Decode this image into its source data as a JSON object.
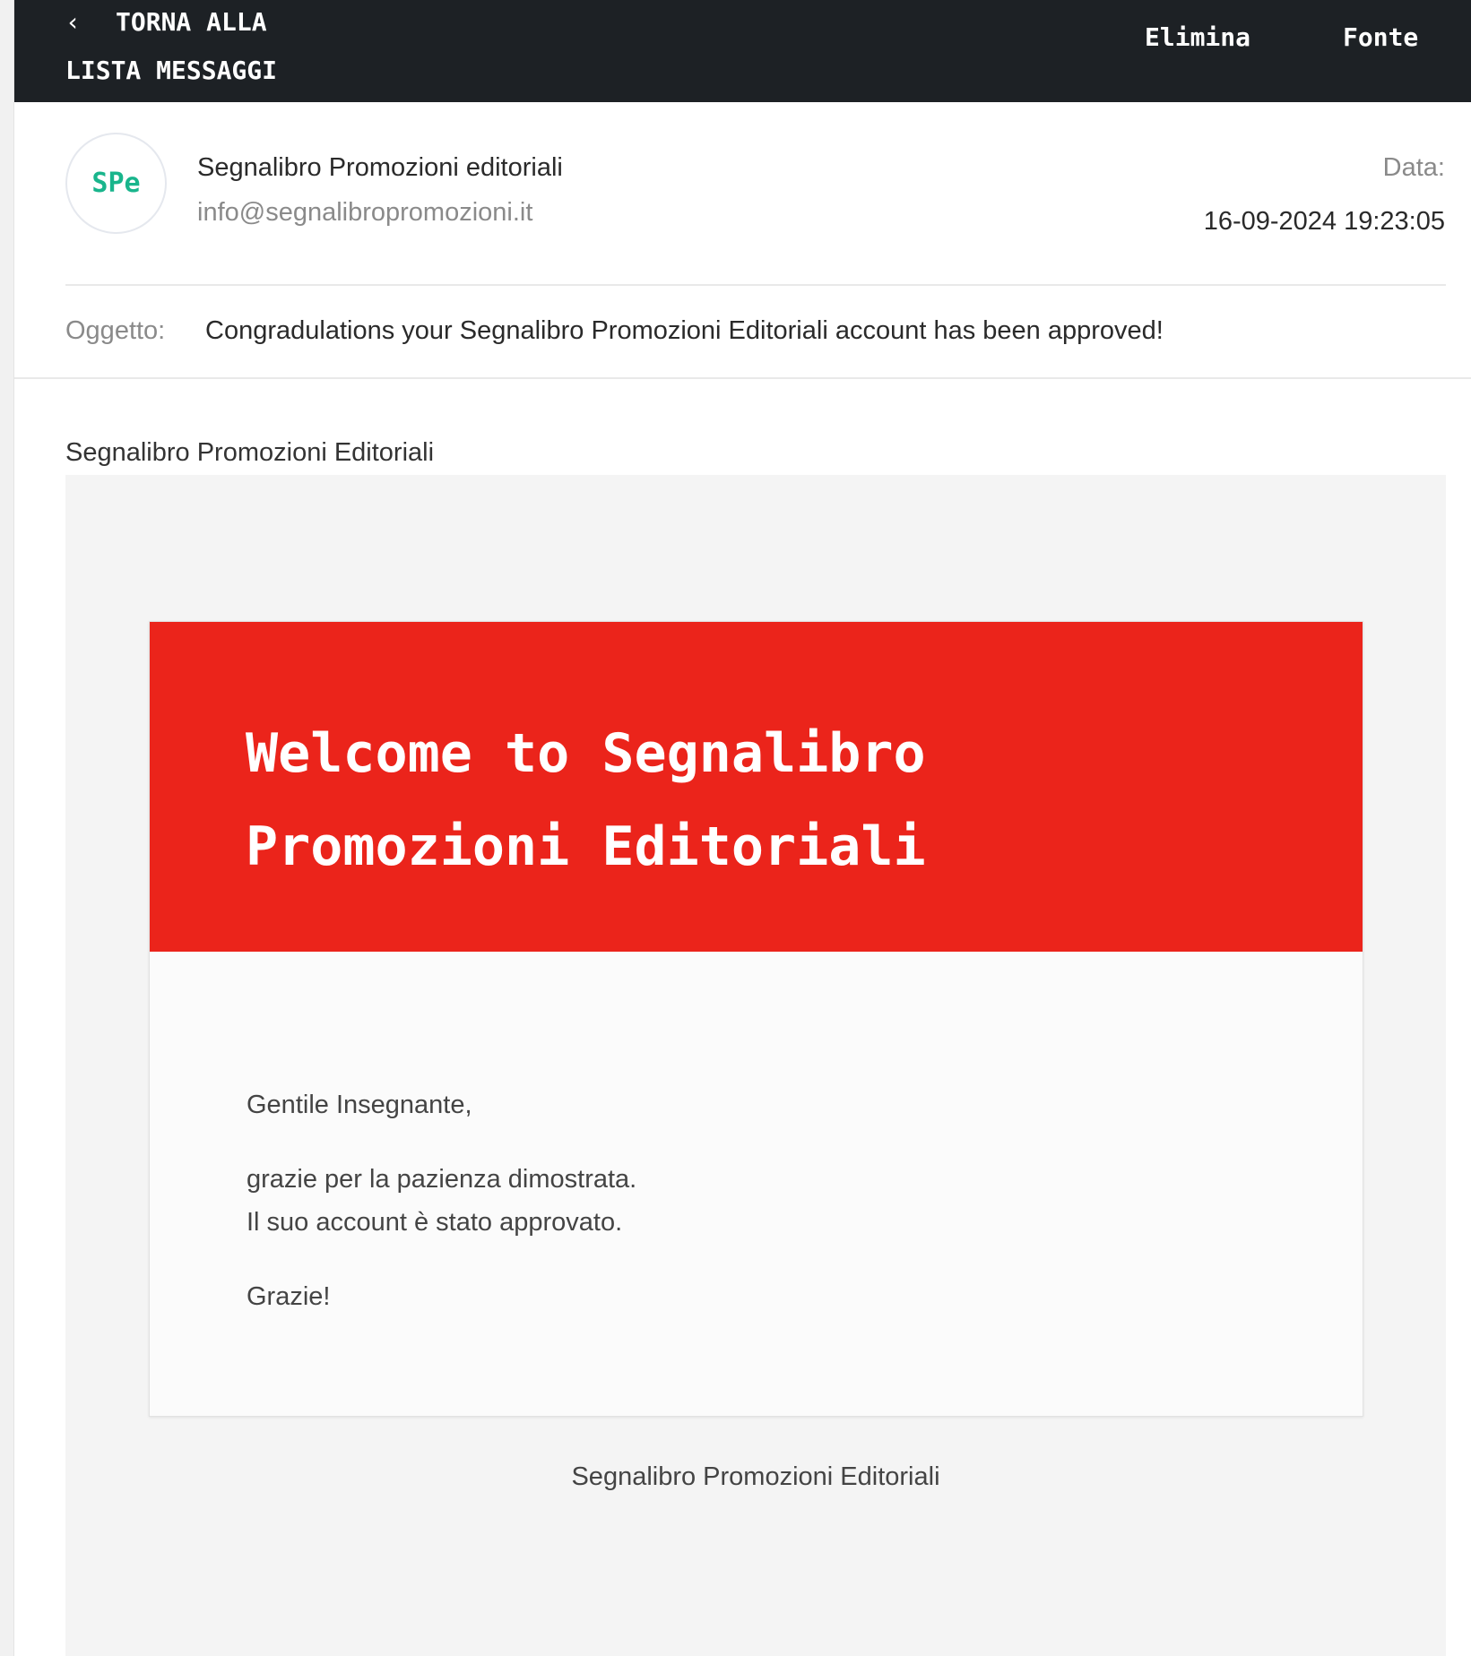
{
  "toolbar": {
    "back_line1": "TORNA ALLA",
    "back_line2": "LISTA MESSAGGI",
    "delete_label": "Elimina",
    "source_label": "Fonte",
    "background": "#1d2125"
  },
  "header": {
    "avatar_initials": "SPe",
    "avatar_color": "#19b58c",
    "sender_name": "Segnalibro Promozioni editoriali",
    "sender_email": "info@segnalibropromozioni.it",
    "date_label": "Data:",
    "date_value": "16-09-2024 19:23:05",
    "subject_label": "Oggetto:",
    "subject": "Congradulations your Segnalibro Promozioni Editoriali account has been approved!"
  },
  "email": {
    "preheader": "Segnalibro Promozioni Editoriali",
    "banner_color": "#eb241b",
    "welcome_line1": "Welcome to Segnalibro",
    "welcome_line2": "Promozioni Editoriali",
    "greeting": "Gentile Insegnante,",
    "body_line1": "grazie per la pazienza dimostrata.",
    "body_line2": "Il suo account è stato approvato.",
    "closing": "Grazie!",
    "footer": "Segnalibro Promozioni Editoriali"
  },
  "icons": {
    "back": "chevron-left-icon"
  }
}
